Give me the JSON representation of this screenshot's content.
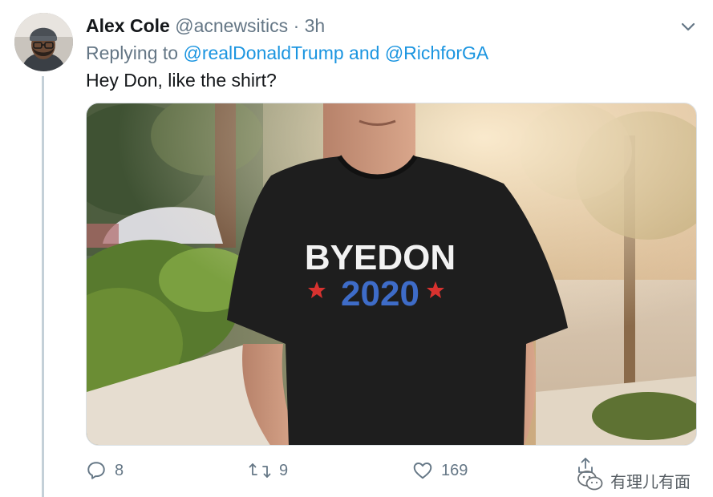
{
  "tweet": {
    "author_name": "Alex Cole",
    "author_handle": "@acnewsitics",
    "separator": "·",
    "time": "3h",
    "replying_prefix": "Replying to",
    "replying_to_1": "@realDonaldTrump",
    "replying_joiner": "and",
    "replying_to_2": "@RichforGA",
    "text": "Hey Don, like the shirt?"
  },
  "media": {
    "shirt_line1": "BYEDON",
    "shirt_line2": "2020",
    "shirt_color": "#1e1e1e",
    "text_white": "#f2f2f2",
    "text_blue": "#3e6cc8",
    "star_red": "#d8322f"
  },
  "actions": {
    "reply_count": "8",
    "retweet_count": "9",
    "like_count": "169"
  },
  "watermark": {
    "text": "有理儿有面"
  },
  "icons": {
    "reply": "reply-icon",
    "retweet": "retweet-icon",
    "like": "heart-icon",
    "share": "share-icon",
    "chevron": "chevron-down-icon",
    "wechat": "wechat-icon"
  },
  "colors": {
    "link": "#1b95e0",
    "secondary_text": "#657786",
    "thread_line": "#c4d0d8"
  }
}
